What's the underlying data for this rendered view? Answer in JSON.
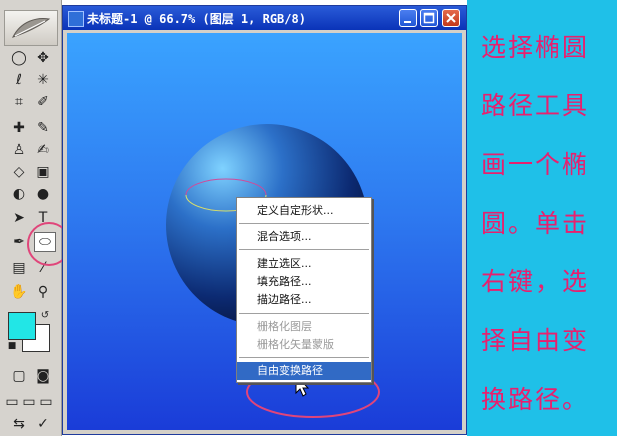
{
  "window": {
    "title": "未标题-1 @ 66.7% (图层 1, RGB/8)"
  },
  "context_menu": {
    "items": [
      {
        "label": "定义自定形状...",
        "enabled": true
      },
      {
        "label": "混合选项...",
        "enabled": true
      },
      {
        "label": "建立选区...",
        "enabled": true
      },
      {
        "label": "填充路径...",
        "enabled": true
      },
      {
        "label": "描边路径...",
        "enabled": true
      },
      {
        "label": "栅格化图层",
        "enabled": false
      },
      {
        "label": "栅格化矢量蒙版",
        "enabled": false
      },
      {
        "label": "自由变换路径",
        "enabled": true,
        "highlighted": true
      }
    ]
  },
  "instructions": {
    "lines": [
      "选择椭圆",
      "路径工具",
      "画一个椭",
      "圆。单击",
      "右键，选",
      "择自由变",
      "换路径。"
    ]
  },
  "colors": {
    "foreground": "#22e6e6",
    "background": "#ffffff",
    "panel_bg": "#1fc0e8",
    "panel_text": "#e8206e",
    "highlight_ring": "#e0457a"
  },
  "toolbox": {
    "icons": [
      "marquee-icon",
      "move-icon",
      "lasso-icon",
      "magic-wand-icon",
      "crop-icon",
      "slice-icon",
      "healing-brush-icon",
      "brush-icon",
      "clone-stamp-icon",
      "history-brush-icon",
      "eraser-icon",
      "gradient-icon",
      "blur-icon",
      "dodge-icon",
      "path-select-icon",
      "type-icon",
      "pen-icon",
      "ellipse-tool-icon",
      "notes-icon",
      "eyedropper-icon",
      "hand-icon",
      "zoom-icon"
    ]
  }
}
